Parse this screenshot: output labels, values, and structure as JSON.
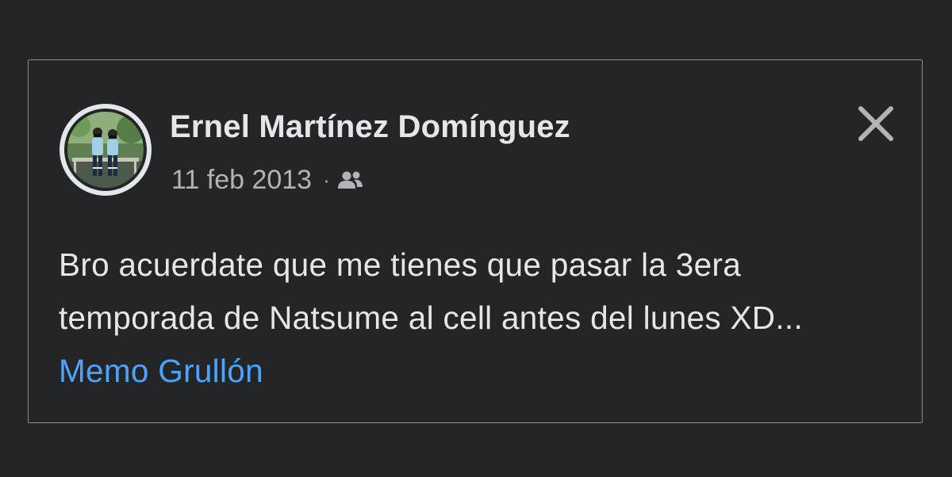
{
  "post": {
    "author_name": "Ernel Martínez Domínguez",
    "date": "11 feb 2013",
    "separator": "·",
    "audience_icon": "friends-icon",
    "text": "Bro acuerdate que me tienes que pasar la 3era temporada de Natsume al cell antes del lunes XD...",
    "mention": "Memo Grullón",
    "close_icon": "close-icon"
  },
  "colors": {
    "background": "#242526",
    "card_border": "#8a8b8d",
    "primary_text": "#e4e6eb",
    "secondary_text": "#b0b3b8",
    "link": "#4da3ff"
  }
}
